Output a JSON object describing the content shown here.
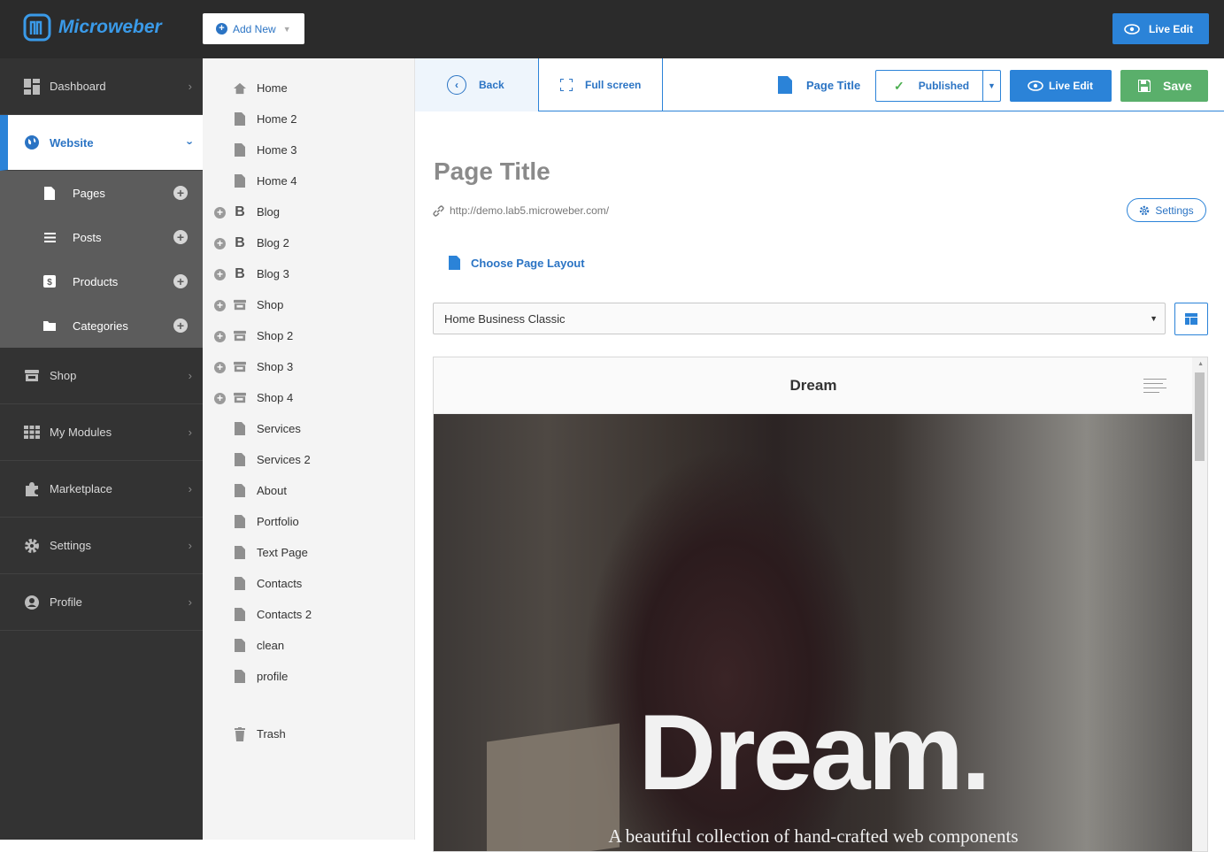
{
  "brand": {
    "name": "Microweber"
  },
  "topbar": {
    "add_new": "Add New",
    "live_edit": "Live Edit"
  },
  "sidebar": {
    "items": [
      {
        "label": "Dashboard",
        "icon": "dashboard-icon"
      },
      {
        "label": "Website",
        "icon": "globe-icon",
        "active": true
      },
      {
        "label": "Shop",
        "icon": "store-icon"
      },
      {
        "label": "My Modules",
        "icon": "grid-icon"
      },
      {
        "label": "Marketplace",
        "icon": "puzzle-icon"
      },
      {
        "label": "Settings",
        "icon": "gear-icon"
      },
      {
        "label": "Profile",
        "icon": "user-icon"
      }
    ],
    "subitems": [
      {
        "label": "Pages",
        "icon": "page-icon"
      },
      {
        "label": "Posts",
        "icon": "posts-icon"
      },
      {
        "label": "Products",
        "icon": "product-icon"
      },
      {
        "label": "Categories",
        "icon": "folder-icon"
      }
    ]
  },
  "tree": {
    "items": [
      "Home",
      "Home 2",
      "Home 3",
      "Home 4",
      "Blog",
      "Blog 2",
      "Blog 3",
      "Shop",
      "Shop 2",
      "Shop 3",
      "Shop 4",
      "Services",
      "Services 2",
      "About",
      "Portfolio",
      "Text Page",
      "Contacts",
      "Contacts 2",
      "clean",
      "profile"
    ],
    "trash": "Trash"
  },
  "toolbar": {
    "back": "Back",
    "full_screen": "Full screen",
    "page_title": "Page Title",
    "published": "Published",
    "live_edit": "Live Edit",
    "save": "Save"
  },
  "editor": {
    "title_placeholder": "Page Title",
    "url": "http://demo.lab5.microweber.com/",
    "settings": "Settings",
    "choose_layout": "Choose Page Layout",
    "layout_value": "Home Business Classic"
  },
  "preview": {
    "brand": "Dream",
    "hero_title": "Dream.",
    "hero_sub": "A beautiful collection of hand-crafted web components"
  },
  "colors": {
    "accent": "#2b83d8",
    "save": "#5aaf6b",
    "sidebar": "#333333",
    "topbar": "#2b2b2b"
  }
}
